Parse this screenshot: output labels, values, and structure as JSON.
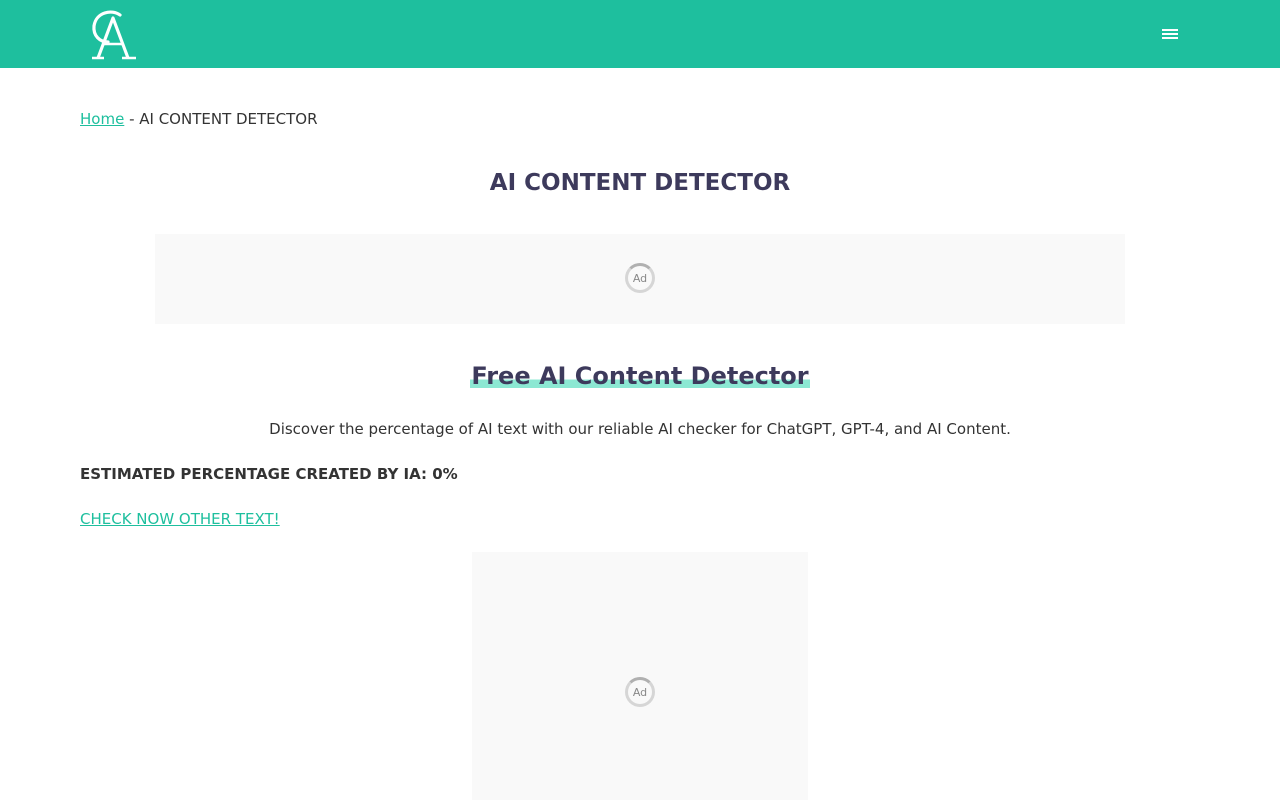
{
  "header": {
    "logo_icon": "ca-monogram-logo",
    "menu_icon": "hamburger-menu-icon",
    "background_color": "#1ebf9e"
  },
  "breadcrumb": {
    "home_label": "Home",
    "separator": " - ",
    "current": "AI CONTENT DETECTOR"
  },
  "page": {
    "title": "AI CONTENT DETECTOR"
  },
  "ads": {
    "top_label": "Ad",
    "bottom_label": "Ad"
  },
  "content": {
    "heading": "Free AI Content Detector",
    "description": "Discover the percentage of AI text with our reliable AI checker for ChatGPT, GPT-4, and AI Content.",
    "estimate": "ESTIMATED PERCENTAGE CREATED BY IA: 0%",
    "check_link": "CHECK NOW OTHER TEXT!"
  },
  "colors": {
    "accent": "#1ebf9e",
    "heading": "#3d3a5c",
    "highlight": "#8ce8d3"
  }
}
